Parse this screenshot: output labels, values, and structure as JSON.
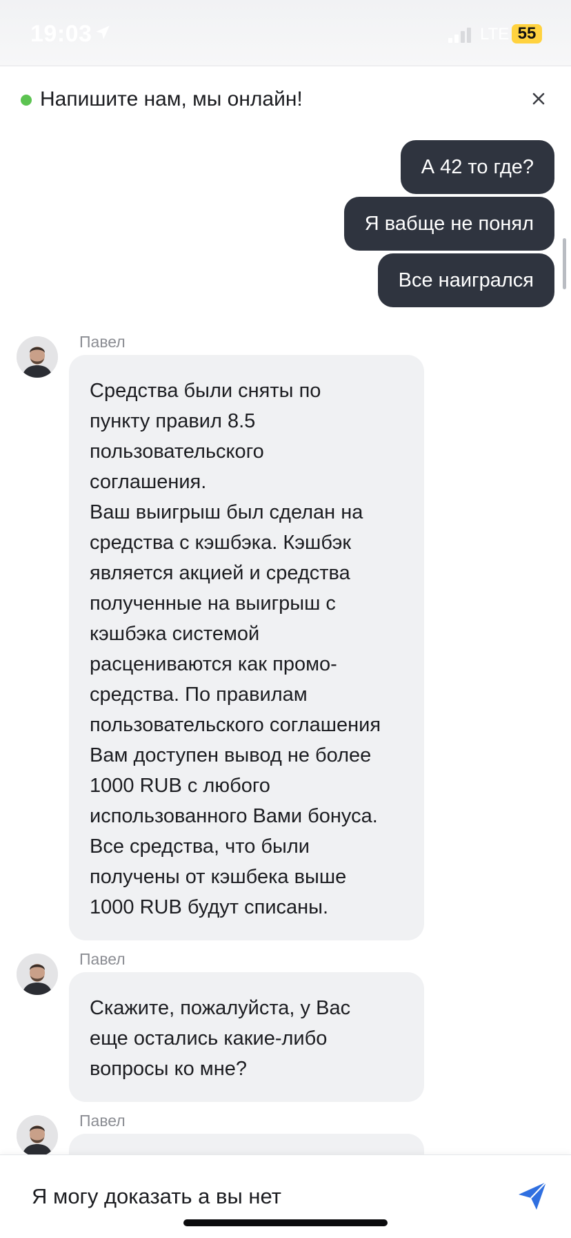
{
  "status_bar": {
    "time": "19:03",
    "network": "LTE",
    "battery": "55",
    "location_icon": "location-arrow-icon",
    "signal_icon": "signal-icon"
  },
  "header": {
    "title": "Напишите нам, мы онлайн!",
    "online_color": "#5cc351",
    "close_icon": "close-icon"
  },
  "outgoing_messages": [
    {
      "text": "А 42 то где?"
    },
    {
      "text": "Я вабще не понял"
    },
    {
      "text": "Все наигрался"
    }
  ],
  "incoming_messages": [
    {
      "sender": "Павел",
      "text": "Средства были сняты по\nпункту правил 8.5\nпользовательского\nсоглашения.\nВаш выигрыш был сделан на\nсредства с кэшбэка. Кэшбэк\nявляется акцией и средства\nполученные на выигрыш с\nкэшбэка системой\nрасцениваются как промо-\nсредства. По правилам\nпользовательского соглашения\nВам доступен вывод не более\n1000 RUB с любого\nиспользованного Вами бонуса.\nВсе средства, что были\nполучены от кэшбека выше\n1000 RUB будут списаны."
    },
    {
      "sender": "Павел",
      "text": "Скажите, пожалуйста, у Вас\nеще остались какие-либо\nвопросы ко мне?"
    },
    {
      "sender": "Павел",
      "text": ""
    }
  ],
  "composer": {
    "value": "Я могу доказать а вы нет",
    "send_icon": "send-icon"
  },
  "colors": {
    "outgoing_bubble": "#2f343f",
    "incoming_bubble": "#f0f1f3",
    "send_accent": "#2f6fe0"
  }
}
